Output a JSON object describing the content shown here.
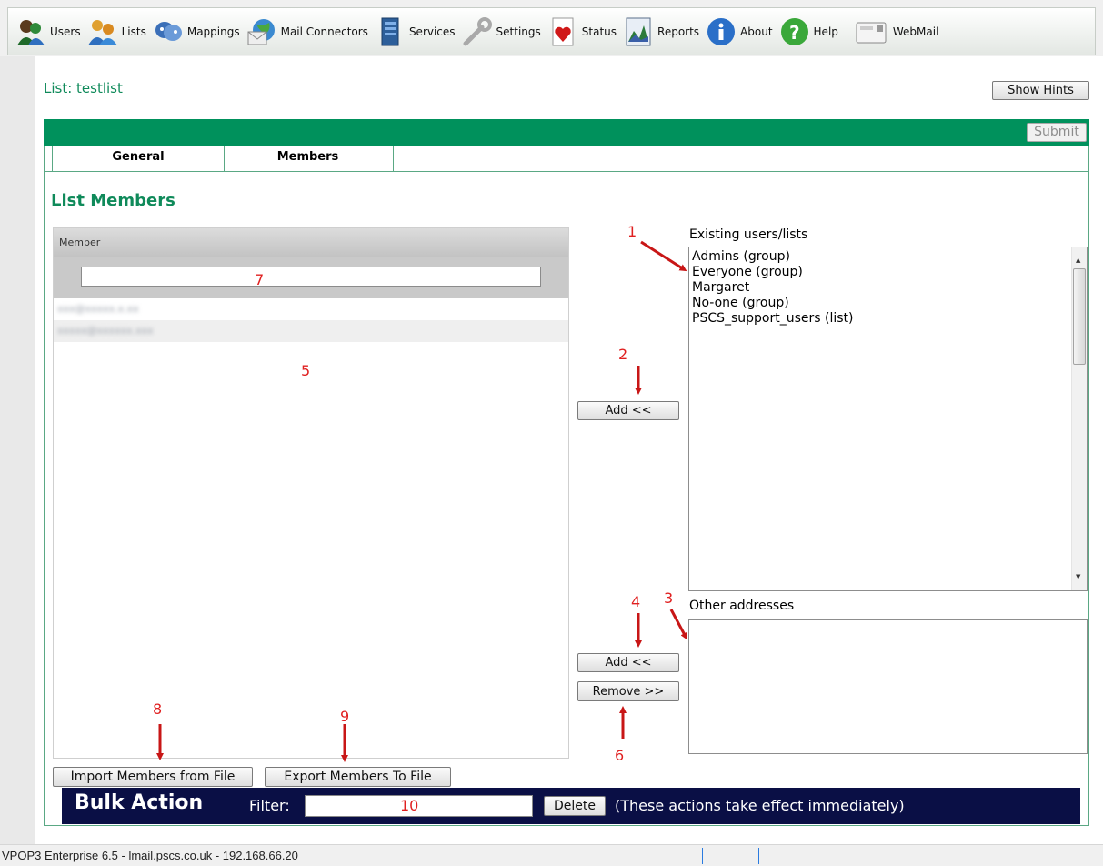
{
  "toolbar": {
    "items": [
      {
        "label": "Users",
        "icon": "users-icon"
      },
      {
        "label": "Lists",
        "icon": "lists-icon"
      },
      {
        "label": "Mappings",
        "icon": "mappings-icon"
      },
      {
        "label": "Mail Connectors",
        "icon": "mail-connectors-icon"
      },
      {
        "label": "Services",
        "icon": "services-icon"
      },
      {
        "label": "Settings",
        "icon": "settings-icon"
      },
      {
        "label": "Status",
        "icon": "status-icon"
      },
      {
        "label": "Reports",
        "icon": "reports-icon"
      },
      {
        "label": "About",
        "icon": "about-icon"
      },
      {
        "label": "Help",
        "icon": "help-icon"
      },
      {
        "label": "WebMail",
        "icon": "webmail-icon"
      }
    ]
  },
  "page": {
    "title": "List: testlist",
    "show_hints": "Show Hints",
    "submit": "Submit",
    "section_title": "List Members"
  },
  "tabs": [
    {
      "label": "General",
      "active": false
    },
    {
      "label": "Members",
      "active": true
    }
  ],
  "members": {
    "column_header": "Member",
    "filter_value": "",
    "rows": [
      "xxx@xxxxx.x.xx",
      "xxxxx@xxxxxx.xxx"
    ]
  },
  "buttons": {
    "add_existing": "Add <<",
    "add_other": "Add <<",
    "remove": "Remove >>",
    "import": "Import Members from File",
    "export": "Export Members To File"
  },
  "existing": {
    "label": "Existing users/lists",
    "options": [
      "Admins (group)",
      "Everyone (group)",
      "Margaret",
      "No-one (group)",
      "PSCS_support_users (list)"
    ]
  },
  "other": {
    "label": "Other addresses",
    "value": ""
  },
  "bulk": {
    "title": "Bulk Action",
    "filter_label": "Filter:",
    "filter_value": "",
    "delete": "Delete",
    "note": "(These actions take effect immediately)"
  },
  "statusbar": {
    "text": "VPOP3 Enterprise 6.5 - lmail.pscs.co.uk - 192.168.66.20"
  },
  "annotations": {
    "labels": [
      "1",
      "2",
      "3",
      "4",
      "5",
      "6",
      "7",
      "8",
      "9",
      "10"
    ],
    "color": "#e02020"
  },
  "colors": {
    "accent_green": "#00915c",
    "title_green": "#0f8a5a",
    "bulk_bar": "#0a0f45"
  }
}
